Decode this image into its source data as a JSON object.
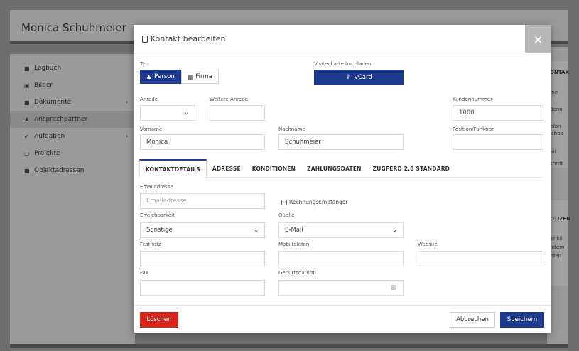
{
  "background": {
    "page_title": "Monica Schuhmeier",
    "sidebar": [
      {
        "icon": "book-icon",
        "glyph": "■",
        "label": "Logbuch",
        "chevron": ""
      },
      {
        "icon": "image-icon",
        "glyph": "▣",
        "label": "Bilder",
        "chevron": ""
      },
      {
        "icon": "file-icon",
        "glyph": "■",
        "label": "Dokumente",
        "chevron": "‹"
      },
      {
        "icon": "users-icon",
        "glyph": "♟",
        "label": "Ansprechpartner",
        "chevron": ""
      },
      {
        "icon": "check-icon",
        "glyph": "✔",
        "label": "Aufgaben",
        "chevron": "‹"
      },
      {
        "icon": "folder-icon",
        "glyph": "▭",
        "label": "Projekte",
        "chevron": ""
      },
      {
        "icon": "building-icon",
        "glyph": "■",
        "label": "Objektadressen",
        "chevron": ""
      }
    ],
    "right_panel": {
      "header1": "ONTAK",
      "rows": [
        "me",
        "denn",
        "efon",
        "ichba",
        "ail",
        "chrift"
      ],
      "header2": "OTIZEN",
      "notes": [
        "er kö",
        "ndern",
        "rden"
      ]
    }
  },
  "modal": {
    "title": "Kontakt bearbeiten",
    "close_label": "×",
    "typ_label": "Typ",
    "typ_options": [
      {
        "icon": "person-icon",
        "glyph": "♟",
        "label": "Person",
        "selected": true
      },
      {
        "icon": "building-icon",
        "glyph": "▦",
        "label": "Firma",
        "selected": false
      }
    ],
    "visitenkarte_label": "Visitenkarte hochladen",
    "vcard_button": "vCard",
    "anrede_label": "Anrede",
    "anrede_value": "",
    "weitere_anrede_label": "Weitere Anrede",
    "weitere_anrede_value": "",
    "kundennummer_label": "Kundennummer",
    "kundennummer_value": "1000",
    "vorname_label": "Vorname",
    "vorname_value": "Monica",
    "nachname_label": "Nachname",
    "nachname_value": "Schuhmeier",
    "position_label": "Position/Funktion",
    "position_value": "",
    "tabs": [
      "KONTAKTDETAILS",
      "ADRESSE",
      "KONDITIONEN",
      "ZAHLUNGSDATEN",
      "ZUGFERD 2.0 STANDARD"
    ],
    "active_tab": "KONTAKTDETAILS",
    "email_label": "Emailadresse",
    "email_placeholder": "Emailadresse",
    "rechnungsempfaenger_label": "Rechnungsempfänger",
    "erreichbarkeit_label": "Erreichbarkeit",
    "erreichbarkeit_value": "Sonstige",
    "quelle_label": "Quelle",
    "quelle_value": "E-Mail",
    "festnetz_label": "Festnetz",
    "mobiltelefon_label": "Mobiltelefon",
    "website_label": "Website",
    "fax_label": "Fax",
    "geburtsdatum_label": "Geburtsdatum",
    "delete_button": "Löschen",
    "cancel_button": "Abbrechen",
    "save_button": "Speichern"
  },
  "colors": {
    "primary": "#1d3a8c",
    "danger": "#d9261c"
  }
}
